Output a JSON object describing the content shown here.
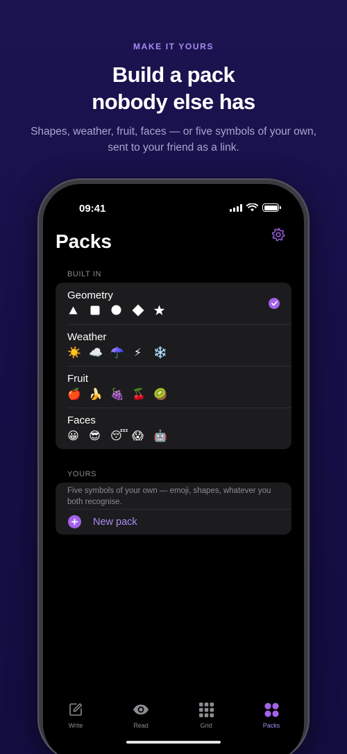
{
  "hero": {
    "eyebrow": "MAKE IT YOURS",
    "headline_line1": "Build a pack",
    "headline_line2": "nobody else has",
    "subline": "Shapes, weather, fruit, faces — or five symbols of your own, sent to your friend as a link."
  },
  "status": {
    "time": "09:41"
  },
  "screen": {
    "title": "Packs",
    "settings_icon": "gear-icon",
    "builtin_label": "BUILT IN",
    "packs": [
      {
        "name": "Geometry",
        "symbols": [
          "▲",
          "■",
          "●",
          "◆",
          "★"
        ],
        "selected": true
      },
      {
        "name": "Weather",
        "symbols": [
          "☀️",
          "☁️",
          "☂️",
          "⚡",
          "❄️"
        ],
        "selected": false
      },
      {
        "name": "Fruit",
        "symbols": [
          "🍎",
          "🍌",
          "🍇",
          "🍒",
          "🥝"
        ],
        "selected": false
      },
      {
        "name": "Faces",
        "symbols": [
          "😀",
          "😎",
          "😴",
          "😱",
          "🤖"
        ],
        "selected": false
      }
    ],
    "yours_label": "YOURS",
    "yours_hint": "Five symbols of your own — emoji, shapes, whatever you both recognise.",
    "new_pack_label": "New pack"
  },
  "tabs": [
    {
      "label": "Write",
      "icon": "compose-icon",
      "active": false
    },
    {
      "label": "Read",
      "icon": "eye-icon",
      "active": false
    },
    {
      "label": "Grid",
      "icon": "grid-icon",
      "active": false
    },
    {
      "label": "Packs",
      "icon": "packs-icon",
      "active": true
    }
  ],
  "colors": {
    "accent": "#a262e8",
    "accent_text": "#a98cf2",
    "card": "#1c1c1e",
    "background": "#160f48"
  }
}
